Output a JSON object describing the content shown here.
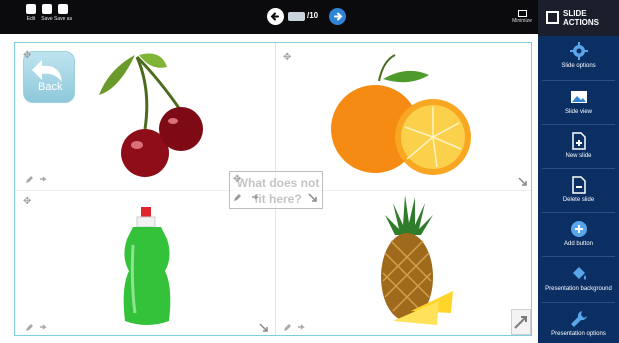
{
  "toolbar": {
    "buttons": [
      {
        "label": "Edit"
      },
      {
        "label": "Save"
      },
      {
        "label": "Save as"
      }
    ],
    "page_current": "",
    "page_total": "/10",
    "minimize_label": "Minimize"
  },
  "slide": {
    "back_label": "Back",
    "question_text": "What does not fit here?",
    "cells": [
      {
        "image": "cherries-image"
      },
      {
        "image": "orange-image"
      },
      {
        "image": "dish-soap-bottle-image"
      },
      {
        "image": "pineapple-image"
      }
    ]
  },
  "panel": {
    "title": "SLIDE ACTIONS",
    "items": [
      {
        "label": "Slide options",
        "icon": "gear-icon"
      },
      {
        "label": "Slide view",
        "icon": "image-icon"
      },
      {
        "label": "New slide",
        "icon": "new-slide-icon"
      },
      {
        "label": "Delete slide",
        "icon": "delete-slide-icon"
      },
      {
        "label": "Add button",
        "icon": "add-icon"
      },
      {
        "label": "Presentation background",
        "icon": "paint-bucket-icon"
      },
      {
        "label": "Presentation options",
        "icon": "wrench-icon"
      }
    ]
  },
  "colors": {
    "toolbar_bg": "#0b0b0d",
    "panel_bg": "#0b2e63",
    "panel_head_bg": "#1b1f2c",
    "accent": "#2f84d6",
    "slide_border": "#7ccfe3"
  }
}
